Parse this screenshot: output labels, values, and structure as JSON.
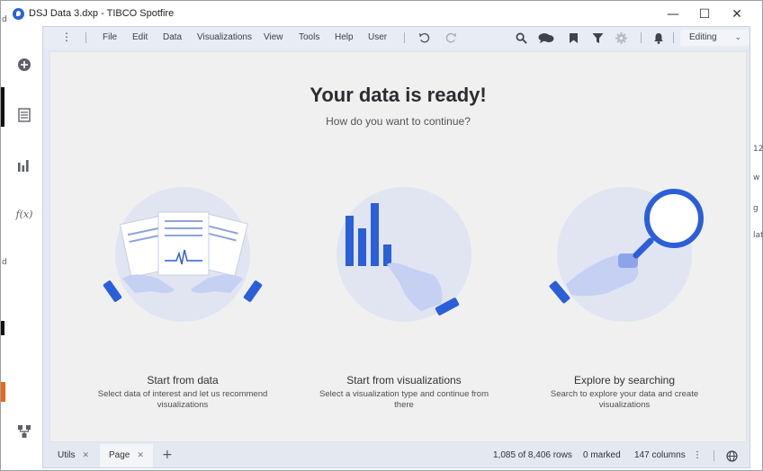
{
  "window": {
    "title": "DSJ Data 3.dxp - TIBCO Spotfire",
    "minimize": "—",
    "maximize": "☐",
    "close": "✕"
  },
  "sidebar": {
    "icons": [
      "add-icon",
      "data-table-icon",
      "bar-chart-icon",
      "function-icon",
      "data-flow-icon"
    ],
    "function_label": "f(x)"
  },
  "toolbar": {
    "menu": [
      "File",
      "Edit",
      "Data",
      "Visualizations",
      "View",
      "Tools",
      "Help",
      "User"
    ],
    "icons": [
      "undo-icon",
      "redo-icon",
      "search-icon",
      "comments-icon",
      "bookmark-icon",
      "filter-icon",
      "settings-icon",
      "notifications-icon"
    ],
    "mode": "Editing"
  },
  "welcome": {
    "title": "Your data is ready!",
    "subtitle": "How do you want to continue?",
    "options": [
      {
        "title": "Start from data",
        "description": "Select data of interest and let us recommend visualizations"
      },
      {
        "title": "Start from visualizations",
        "description": "Select a visualization type and continue from there"
      },
      {
        "title": "Explore by searching",
        "description": "Search to explore your data and create visualizations"
      }
    ]
  },
  "statusbar": {
    "tabs": [
      {
        "label": "Utils",
        "active": false
      },
      {
        "label": "Page",
        "active": true
      }
    ],
    "add_page": "+",
    "rows": "1,085 of 8,406 rows",
    "marked": "0 marked",
    "columns": "147 columns",
    "more": "⋮"
  },
  "colors": {
    "accent": "#2b5fd9",
    "illustration_light": "#e1e5f2",
    "canvas_bg": "#f0f0f0",
    "chrome_bg": "#e4e8f1"
  }
}
